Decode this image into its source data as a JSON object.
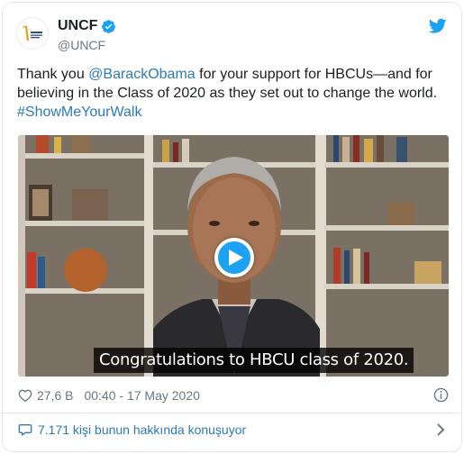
{
  "author": {
    "display_name": "UNCF",
    "handle": "@UNCF",
    "verified": true,
    "avatar_icon": "uncf-logo"
  },
  "tweet": {
    "text_1": "Thank you ",
    "mention": "@BarackObama",
    "text_2": " for your support for HBCUs—and for believing in the Class of 2020 as they set out to change the world. ",
    "hashtag": "#ShowMeYourWalk"
  },
  "media": {
    "type": "video",
    "caption": "Congratulations to HBCU class of 2020."
  },
  "meta": {
    "likes": "27,6 B",
    "timestamp": "00:40 - 17 May 2020"
  },
  "conversation": {
    "label": "7.171 kişi bunun hakkında konuşuyor"
  },
  "colors": {
    "link": "#2b7bb9",
    "twitter_blue": "#1da1f2",
    "muted": "#697882"
  }
}
